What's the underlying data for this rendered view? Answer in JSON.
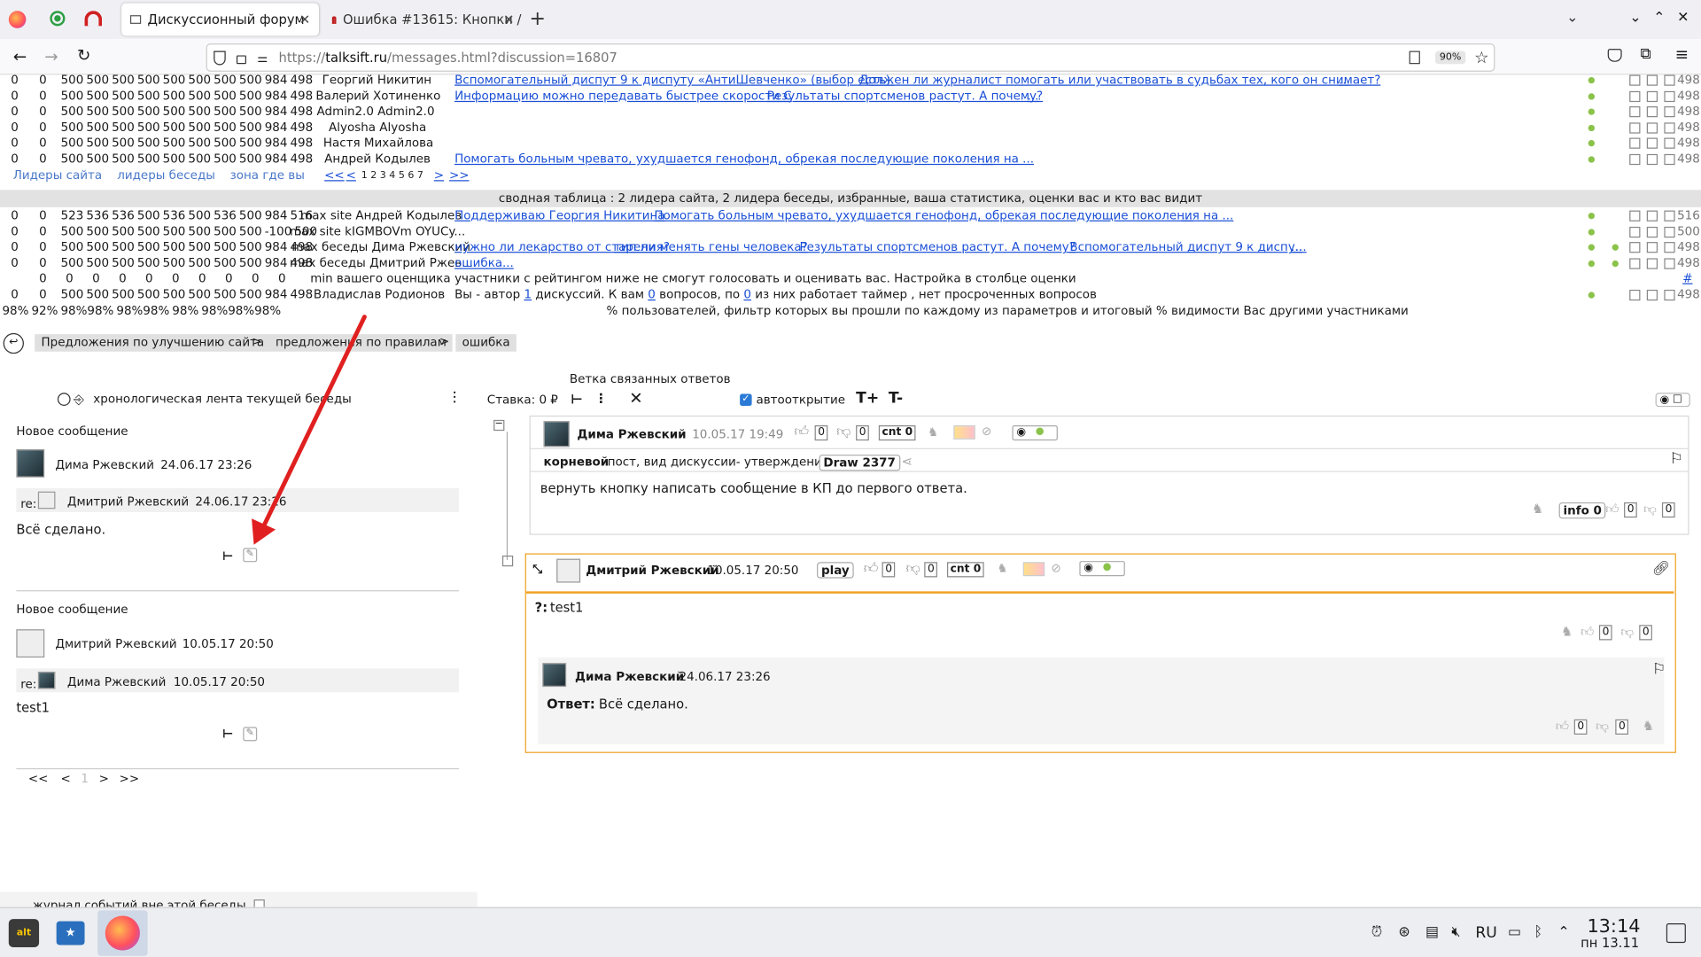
{
  "browser": {
    "tabs": [
      {
        "label": "Дискуссионный форум"
      },
      {
        "label": "Ошибка #13615: Кнопки /"
      }
    ],
    "url_prefix": "https://",
    "url_domain": "talksift.ru",
    "url_path": "/messages.html?discussion=16807",
    "zoom": "90%"
  },
  "top_rows": [
    {
      "c1": "0",
      "c2": "0",
      "nums": "500 500 500 500 500 500 500 500 984 498",
      "name": "Георгий Никитин",
      "links": [
        "Вспомогательный диспут 9 к диспуту «АнтиШевченко» (выбор есть).",
        "Должен ли журналист помогать или участвовать в судьбах тех, кого он снимает?",
        "..."
      ],
      "tail": "498"
    },
    {
      "c1": "0",
      "c2": "0",
      "nums": "500 500 500 500 500 500 500 500 984 498",
      "name": "Валерий Хотиненко",
      "links": [
        "Информацию можно передавать быстрее скорости С",
        "Результаты спортсменов растут. А почему?",
        "..."
      ],
      "tail": "498"
    },
    {
      "c1": "0",
      "c2": "0",
      "nums": "500 500 500 500 500 500 500 500 984 498",
      "name": "Admin2.0 Admin2.0",
      "links": [],
      "tail": "498"
    },
    {
      "c1": "0",
      "c2": "0",
      "nums": "500 500 500 500 500 500 500 500 984 498",
      "name": "Alyosha Alyosha",
      "links": [],
      "tail": "498"
    },
    {
      "c1": "0",
      "c2": "0",
      "nums": "500 500 500 500 500 500 500 500 984 498",
      "name": "Настя Михайлова",
      "links": [],
      "tail": "498"
    },
    {
      "c1": "0",
      "c2": "0",
      "nums": "500 500 500 500 500 500 500 500 984 498",
      "name": "Андрей Кодылев",
      "links": [
        "Помогать больным чревато, ухудшается генофонд, обрекая последующие поколения на ...",
        "..."
      ],
      "tail": "498"
    }
  ],
  "leader_tabs": [
    "Лидеры сайта",
    "лидеры беседы",
    "зона где вы"
  ],
  "pager_top": {
    "first": "<<",
    "prev": "<",
    "pages": "1 2 3 4 5 6 7",
    "next": ">",
    "last": ">>"
  },
  "summary_header": "сводная таблица : 2 лидера сайта, 2 лидера беседы, избранные, ваша статистика, оценки вас и кто вас видит",
  "summary_rows": [
    {
      "c1": "0",
      "c2": "0",
      "nums": "523 536 536 500 536 500 536 500 984 516",
      "name": "max site Андрей Кодылев",
      "links": [
        "Поддерживаю Георгия Никитина",
        "Помогать больным чревато, ухудшается генофонд, обрекая последующие поколения на ...",
        "..."
      ],
      "tail": "516"
    },
    {
      "c1": "0",
      "c2": "0",
      "nums": "500 500 500 500 500 500 500 500 -100 500",
      "name": "max site kIGMBOVm OYUCy...",
      "links": [],
      "tail": "500"
    },
    {
      "c1": "0",
      "c2": "0",
      "nums": "500 500 500 500 500 500 500 500 984 498",
      "name": "max беседы Дима Ржевский",
      "links": [
        "нужно ли лекарство от старения?",
        "тип ли менять гены человека?",
        "Результаты спортсменов растут. А почему?",
        "Вспомогательный диспут 9 к диспу...",
        "..."
      ],
      "tail": "498"
    },
    {
      "c1": "0",
      "c2": "0",
      "nums": "500 500 500 500 500 500 500 500 984 498",
      "name": "max беседы Дмитрий Ржев...",
      "links": [
        "ошибка",
        "..."
      ],
      "tail": "498"
    }
  ],
  "min_row": {
    "nums": "0 0 0 0 0 0 0 0 0 0",
    "name": "min вашего оценщика",
    "text": "участники с рейтингом ниже не смогут голосовать и оценивать вас. Настройка в столбце оценки",
    "hash": "#"
  },
  "self_row": {
    "c1": "0",
    "c2": "0",
    "nums": "500 500 500 500 500 500 500 500 984 498",
    "name": "Владислав Родионов",
    "t1": "Вы - автор ",
    "n1": "1",
    "t2": " дискуссий. К вам ",
    "n2": "0",
    "t3": " вопросов, по ",
    "n3": "0",
    "t4": " из них работает таймер , нет просроченных вопросов",
    "tail": "498"
  },
  "pct_row": {
    "nums": "98% 92% 98%98% 98%98% 98% 98%98%98%",
    "text": "% пользователей, фильтр которых вы прошли по каждому из параметров и итоговый % видимости Вас другими участниками"
  },
  "breadcrumb": [
    "Предложения по улучшению сайта",
    "предложения по правилам",
    "ошибка"
  ],
  "toolbar": {
    "branch_title": "Ветка связанных ответов",
    "feed_label": "хронологическая лента текущей беседы",
    "stake": "Ставка: 0 ₽",
    "autoopen": "автооткрытие",
    "font_up": "T+",
    "font_down": "T-"
  },
  "left_messages": [
    {
      "header": "Новое сообщение",
      "author": "Дима Ржевский",
      "date": "24.06.17 23:26",
      "re": "re:",
      "re_author": "Дмитрий Ржевский",
      "re_date": "24.06.17 23:26",
      "text": "Всё сделано."
    },
    {
      "header": "Новое сообщение",
      "author": "Дмитрий Ржевский",
      "date": "10.05.17 20:50",
      "re": "re:",
      "re_author": "Дима Ржевский",
      "re_date": "10.05.17 20:50",
      "text": "test1"
    }
  ],
  "left_pager": {
    "first": "<<",
    "prev": "<",
    "page": "1",
    "next": ">",
    "last": ">>"
  },
  "left_footer": "журнал событий вне этой беседы",
  "right": {
    "msg1": {
      "author": "Дима Ржевский",
      "date": "10.05.17 19:49",
      "likes": "0",
      "dislikes": "0",
      "cnt": "cnt 0",
      "sub_author": "корневой",
      "sub_text": "пост, вид дискуссии- утверждение",
      "draw": "Draw 2377",
      "body": "вернуть кнопку написать сообщение в КП до первого ответа.",
      "info": "info 0",
      "b_likes": "0",
      "b_dislikes": "0"
    },
    "msg2": {
      "author": "Дмитрий Ржевский",
      "date": "10.05.17 20:50",
      "play": "play",
      "likes": "0",
      "dislikes": "0",
      "cnt": "cnt 0",
      "q_label": "?:",
      "q_text": "test1",
      "q_likes": "0",
      "q_dislikes": "0"
    },
    "reply": {
      "author": "Дима Ржевский",
      "date": "24.06.17 23:26",
      "a_label": "Ответ:",
      "a_text": "Всё сделано.",
      "likes": "0",
      "dislikes": "0"
    }
  },
  "taskbar": {
    "lang": "RU",
    "time": "13:14",
    "date": "пн 13.11"
  },
  "colors": {
    "link": "#1a4fd6",
    "accent": "#f0a020",
    "arrow": "#e02020",
    "green": "#8bc34a"
  }
}
